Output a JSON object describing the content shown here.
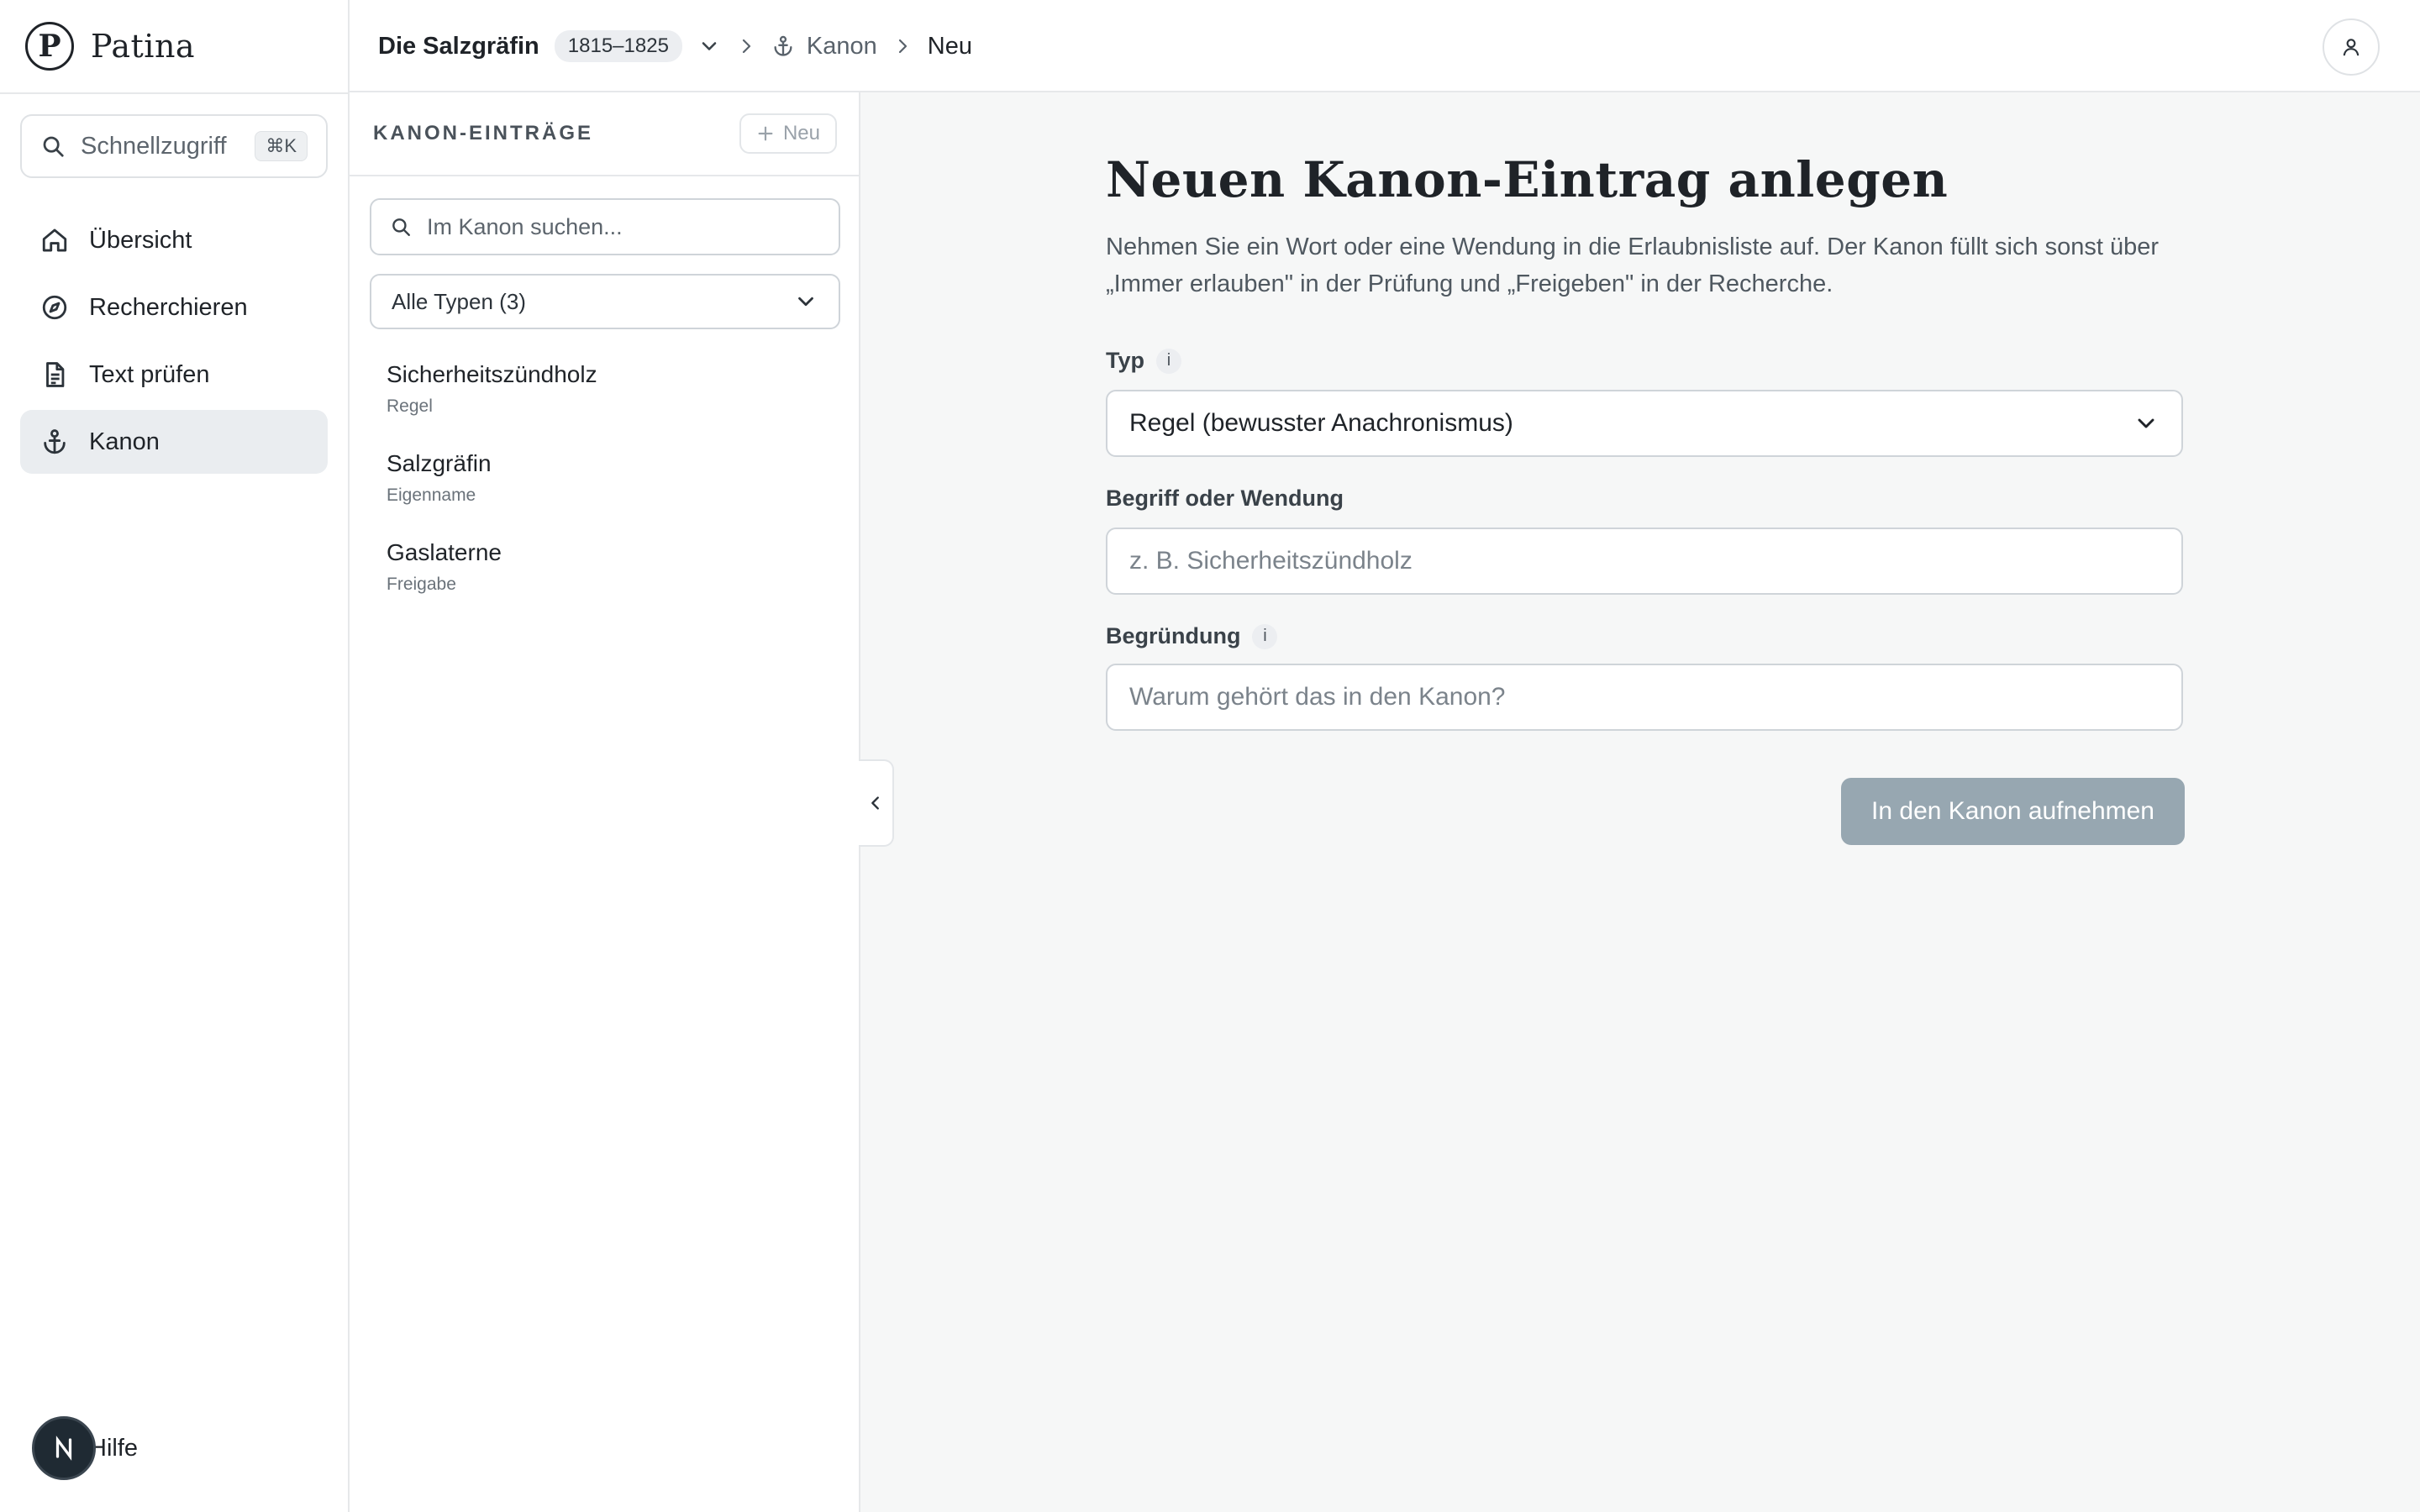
{
  "app": {
    "logo_letter": "P",
    "name": "Patina"
  },
  "sidebar": {
    "quick_access": {
      "label": "Schnellzugriff",
      "shortcut": "⌘K"
    },
    "items": [
      {
        "label": "Übersicht",
        "icon": "home-icon",
        "active": false
      },
      {
        "label": "Recherchieren",
        "icon": "compass-icon",
        "active": false
      },
      {
        "label": "Text prüfen",
        "icon": "document-icon",
        "active": false
      },
      {
        "label": "Kanon",
        "icon": "anchor-icon",
        "active": true
      }
    ],
    "help_label": "Hilfe"
  },
  "header": {
    "project": "Die Salzgräfin",
    "years": "1815–1825",
    "breadcrumb": {
      "section": "Kanon",
      "current": "Neu"
    }
  },
  "list": {
    "title": "KANON-EINTRÄGE",
    "new_label": "Neu",
    "search_placeholder": "Im Kanon suchen...",
    "filter_value": "Alle Typen (3)",
    "entries": [
      {
        "name": "Sicherheitszündholz",
        "type": "Regel"
      },
      {
        "name": "Salzgräfin",
        "type": "Eigenname"
      },
      {
        "name": "Gaslaterne",
        "type": "Freigabe"
      }
    ]
  },
  "form": {
    "heading": "Neuen Kanon-Eintrag anlegen",
    "intro": "Nehmen Sie ein Wort oder eine Wendung in die Erlaubnisliste auf. Der Kanon füllt sich sonst über „Immer erlauben\" in der Prüfung und „Freigeben\" in der Recherche.",
    "type_label": "Typ",
    "type_value": "Regel (bewusster Anachronismus)",
    "term_label": "Begriff oder Wendung",
    "term_placeholder": "z. B. Sicherheitszündholz",
    "reason_label": "Begründung",
    "reason_placeholder": "Warum gehört das in den Kanon?",
    "info_glyph": "i",
    "submit_label": "In den Kanon aufnehmen"
  },
  "colors": {
    "accent_disabled": "#97a7b1",
    "active_nav": "#eaedf0",
    "help_avatar": "#1f2a33"
  }
}
